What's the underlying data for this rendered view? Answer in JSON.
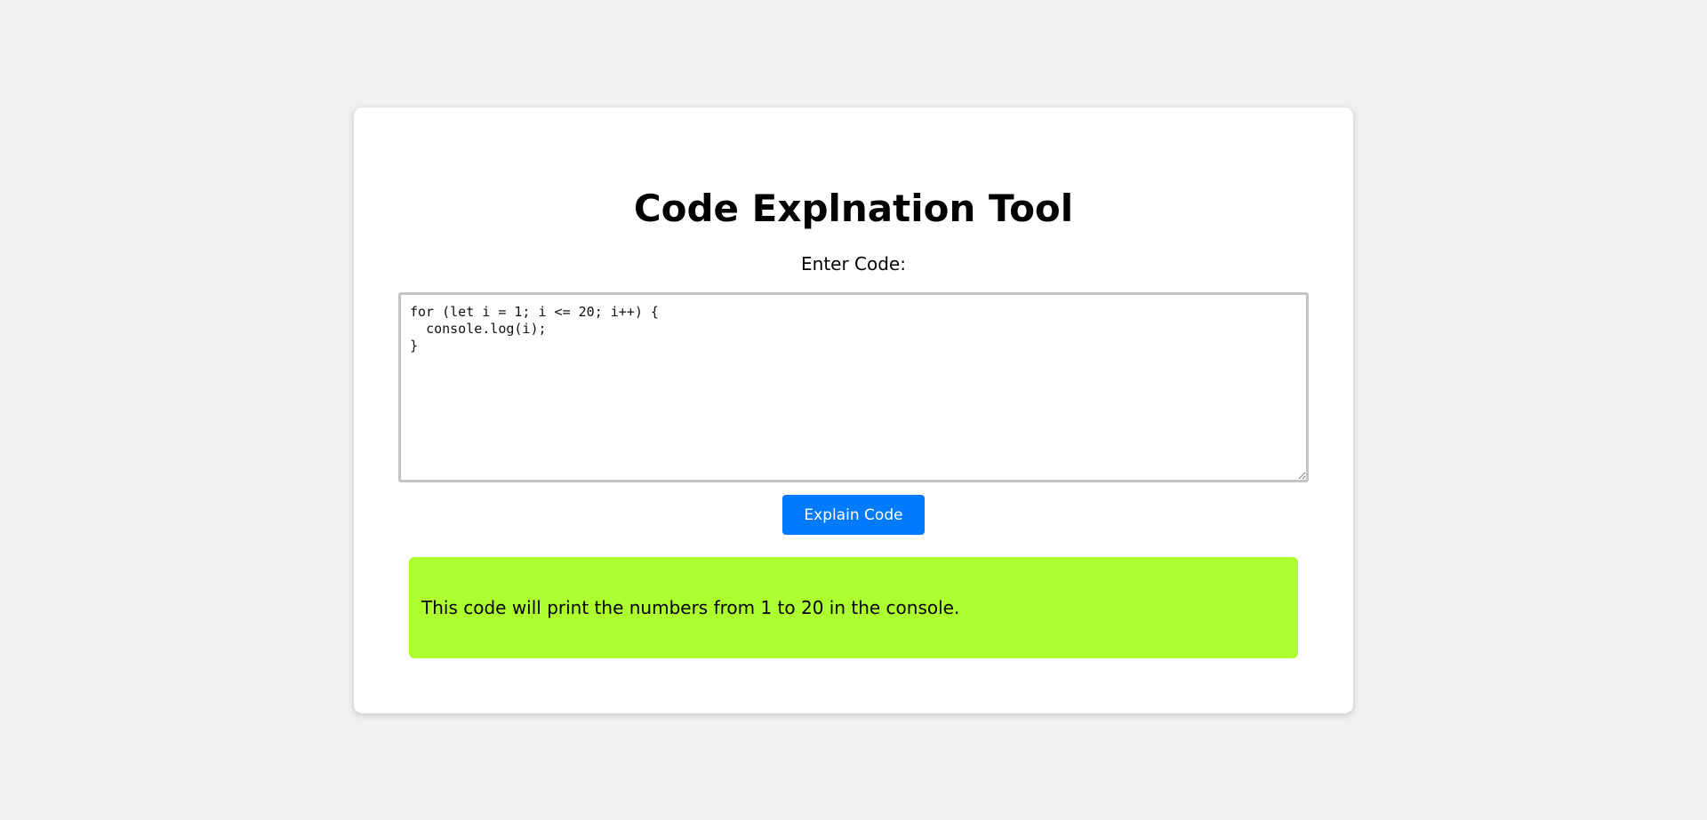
{
  "page": {
    "title": "Code Explnation Tool",
    "input_label": "Enter Code:"
  },
  "editor": {
    "code": "for (let i = 1; i <= 20; i++) {\n  console.log(i);\n}"
  },
  "actions": {
    "explain_label": "Explain Code"
  },
  "result": {
    "text": "This code will print the numbers from 1 to 20 in the console."
  },
  "colors": {
    "background": "#f0f0f0",
    "card": "#ffffff",
    "button": "#007bff",
    "result_bg": "#adff2f"
  }
}
